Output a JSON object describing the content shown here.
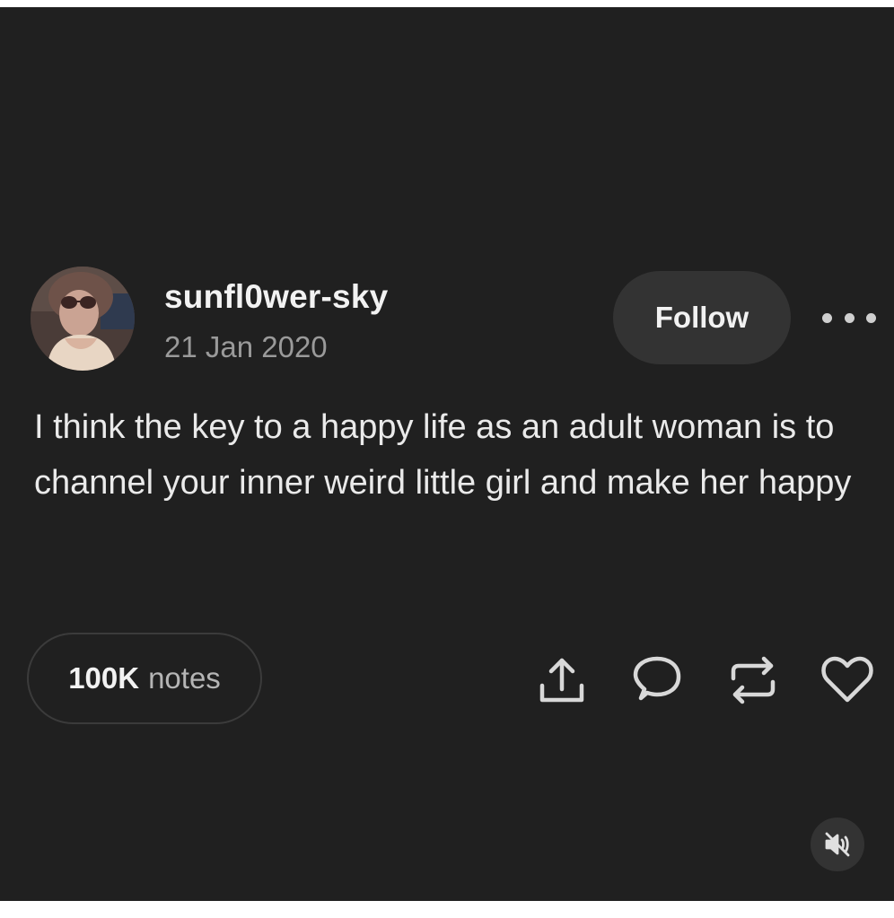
{
  "post": {
    "author": {
      "username": "sunfl0wer-sky",
      "date": "21 Jan 2020",
      "avatar_icon": "user-avatar-photo"
    },
    "follow_label": "Follow",
    "more_icon": "more-horizontal-icon",
    "body": "I think the key to a happy life as an adult woman is to channel your inner weird little girl and make her happy",
    "notes": {
      "count": "100K",
      "label": "notes"
    },
    "actions": [
      {
        "name": "share",
        "icon": "share-icon"
      },
      {
        "name": "reply",
        "icon": "reply-icon"
      },
      {
        "name": "reblog",
        "icon": "reblog-icon"
      },
      {
        "name": "like",
        "icon": "heart-icon"
      }
    ]
  },
  "media": {
    "mute_icon": "volume-muted-icon"
  },
  "colors": {
    "background": "#202020",
    "button_background": "#333333",
    "text_primary": "#f2f2f2",
    "text_secondary": "#9a9a9a",
    "icon": "#d8d8d8"
  }
}
